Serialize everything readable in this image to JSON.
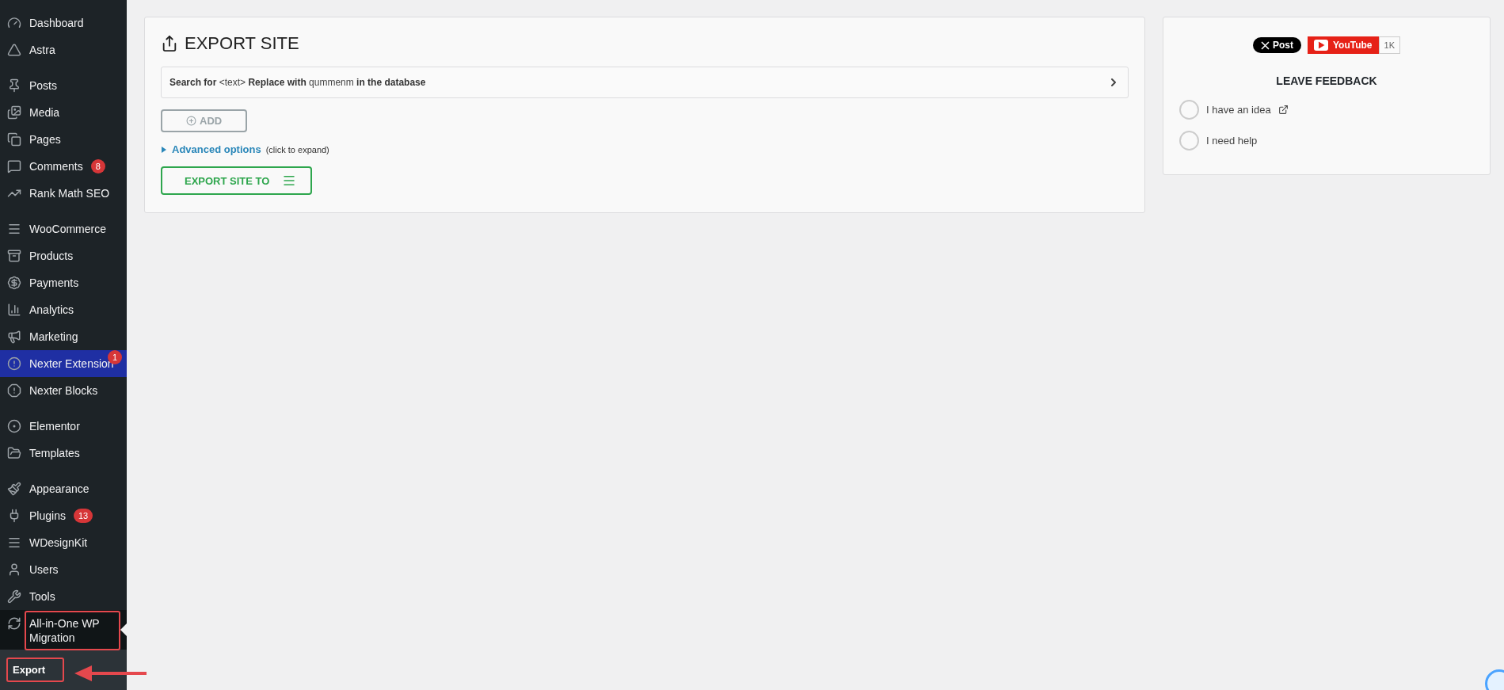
{
  "sidebar": {
    "items": [
      {
        "kind": "item",
        "label": "Dashboard",
        "selected": false,
        "highlighted": false
      },
      {
        "kind": "item",
        "label": "Astra",
        "selected": false,
        "highlighted": false
      },
      {
        "kind": "separator"
      },
      {
        "kind": "item",
        "label": "Posts",
        "selected": false,
        "highlighted": false
      },
      {
        "kind": "item",
        "label": "Media",
        "selected": false,
        "highlighted": false
      },
      {
        "kind": "item",
        "label": "Pages",
        "selected": false,
        "highlighted": false
      },
      {
        "kind": "item",
        "label": "Comments",
        "badge": "8",
        "selected": false,
        "highlighted": false
      },
      {
        "kind": "item",
        "label": "Rank Math SEO",
        "selected": false,
        "highlighted": false
      },
      {
        "kind": "separator"
      },
      {
        "kind": "item",
        "label": "WooCommerce",
        "selected": false,
        "highlighted": false
      },
      {
        "kind": "item",
        "label": "Products",
        "selected": false,
        "highlighted": false
      },
      {
        "kind": "item",
        "label": "Payments",
        "selected": false,
        "highlighted": false
      },
      {
        "kind": "item",
        "label": "Analytics",
        "selected": false,
        "highlighted": false
      },
      {
        "kind": "item",
        "label": "Marketing",
        "selected": false,
        "highlighted": false
      },
      {
        "kind": "item",
        "label": "Nexter Extension",
        "corner_badge": "1",
        "selected": false,
        "highlighted": true
      },
      {
        "kind": "item",
        "label": "Nexter Blocks",
        "selected": false,
        "highlighted": false
      },
      {
        "kind": "separator"
      },
      {
        "kind": "item",
        "label": "Elementor",
        "selected": false,
        "highlighted": false
      },
      {
        "kind": "item",
        "label": "Templates",
        "selected": false,
        "highlighted": false
      },
      {
        "kind": "separator"
      },
      {
        "kind": "item",
        "label": "Appearance",
        "selected": false,
        "highlighted": false
      },
      {
        "kind": "item",
        "label": "Plugins",
        "badge": "13",
        "selected": false,
        "highlighted": false
      },
      {
        "kind": "item",
        "label": "WDesignKit",
        "selected": false,
        "highlighted": false
      },
      {
        "kind": "item",
        "label": "Users",
        "selected": false,
        "highlighted": false
      },
      {
        "kind": "item",
        "label": "Tools",
        "selected": false,
        "highlighted": false
      },
      {
        "kind": "item",
        "label": "All-in-One WP Migration",
        "selected": true,
        "highlighted": false,
        "annotated": true
      }
    ],
    "submenu": [
      {
        "label": "Export",
        "selected": true,
        "annotated": true
      }
    ]
  },
  "export_panel": {
    "title": "EXPORT SITE",
    "find_replace": "**Search for** <text> **Replace with** qummenm **in the database**",
    "add_button": {
      "label": "ADD",
      "disabled": true
    },
    "advanced": {
      "label": "Advanced options",
      "hint": "(click to expand)",
      "expanded": false
    },
    "export_button": "EXPORT SITE TO"
  },
  "side_panel": {
    "x_button": "Post",
    "youtube_button": "YouTube",
    "youtube_count": "1K",
    "heading": "LEAVE FEEDBACK",
    "options": [
      {
        "label": "I have an idea",
        "external": true,
        "selected": false
      },
      {
        "label": "I need help",
        "external": false,
        "selected": false
      }
    ]
  }
}
